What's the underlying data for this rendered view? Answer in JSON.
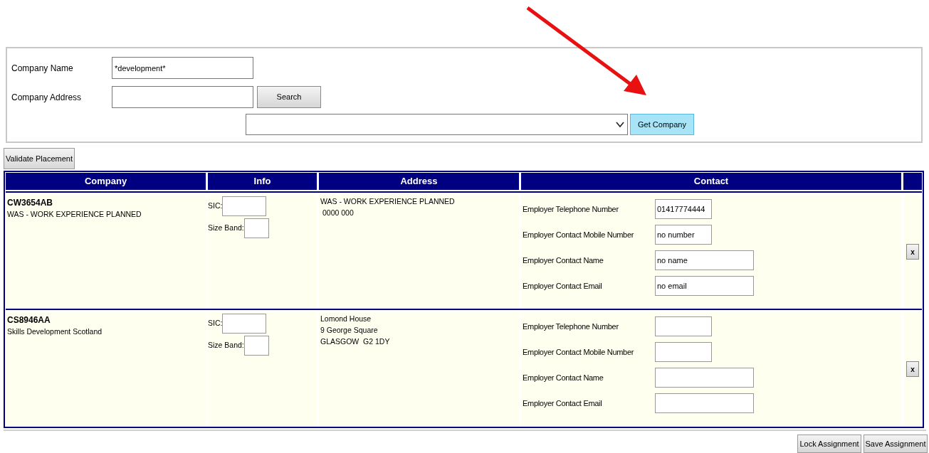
{
  "search_panel": {
    "fields": [
      {
        "label": "Company Name",
        "value": "*development*"
      },
      {
        "label": "Company Address"
      }
    ],
    "search_button": "Search",
    "get_company_button": "Get Company"
  },
  "validate_button": "Validate Placement",
  "table": {
    "columns": [
      "Company",
      "Info",
      "Address",
      "Contact"
    ],
    "rows": [
      {
        "code": "CW3654AB",
        "name": "WAS - WORK EXPERIENCE PLANNED",
        "info_fields": [
          {
            "label": "SIC:"
          },
          {
            "label": "Size Band:"
          }
        ],
        "address_lines": [
          "WAS - WORK EXPERIENCE PLANNED",
          "0000 000"
        ],
        "contacts": [
          {
            "label": "Employer Telephone Number",
            "value": "01417774444"
          },
          {
            "label": "Employer Contact Mobile Number",
            "value": "no number"
          },
          {
            "label": "Employer Contact Name",
            "value": "no name"
          },
          {
            "label": "Employer Contact Email",
            "value": "no email"
          }
        ],
        "remove_button": "x"
      },
      {
        "code": "CS8946AA",
        "name": "Skills Development Scotland",
        "info_fields": [
          {
            "label": "SIC:"
          },
          {
            "label": "Size Band:"
          }
        ],
        "address_lines": [
          "Lomond House",
          "9 George Square",
          "GLASGOW  G2 1DY"
        ],
        "contacts": [
          {
            "label": "Employer Telephone Number"
          },
          {
            "label": "Employer Contact Mobile Number"
          },
          {
            "label": "Employer Contact Name"
          },
          {
            "label": "Employer Contact Email"
          }
        ],
        "remove_button": "x"
      }
    ]
  },
  "footer_buttons": [
    "Lock Assignment",
    "Save Assignment"
  ]
}
